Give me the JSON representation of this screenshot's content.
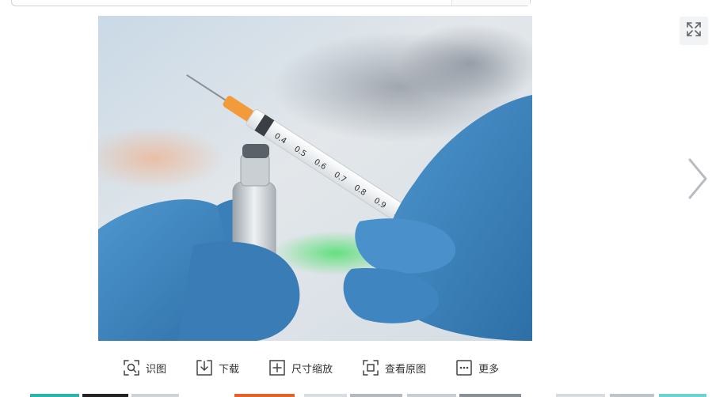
{
  "toolbar": {
    "identify_label": "识图",
    "download_label": "下载",
    "resize_label": "尺寸缩放",
    "original_label": "查看原图",
    "more_label": "更多"
  },
  "icons": {
    "identify": "image-search-icon",
    "download": "download-icon",
    "resize": "resize-icon",
    "original": "view-original-icon",
    "more": "more-icon",
    "fullscreen": "fullscreen-expand-icon",
    "next": "chevron-right-icon"
  },
  "colors": {
    "glove": "#3f86c0",
    "toolbar_text": "#333333",
    "icon_stroke": "#444444",
    "arrow": "#b8bcc2"
  }
}
